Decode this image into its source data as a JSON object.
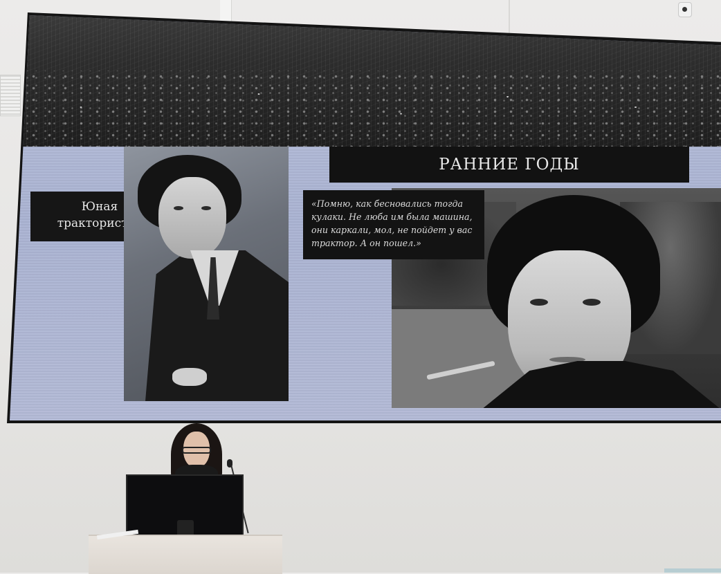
{
  "slide": {
    "title": "РАННИЕ ГОДЫ",
    "caption_left_line1": "Юная",
    "caption_left_line2": "трактористка",
    "quote_lines": [
      "«Помню, как бесновались тогда",
      "кулаки. Не люба им была машина,",
      "они каркали, мол, не пойдет у вас",
      "трактор. А он пошел.»"
    ]
  },
  "colors": {
    "slide_background": "#aab3d2",
    "box_dark": "#131313",
    "box_text": "#e7e7e7"
  }
}
